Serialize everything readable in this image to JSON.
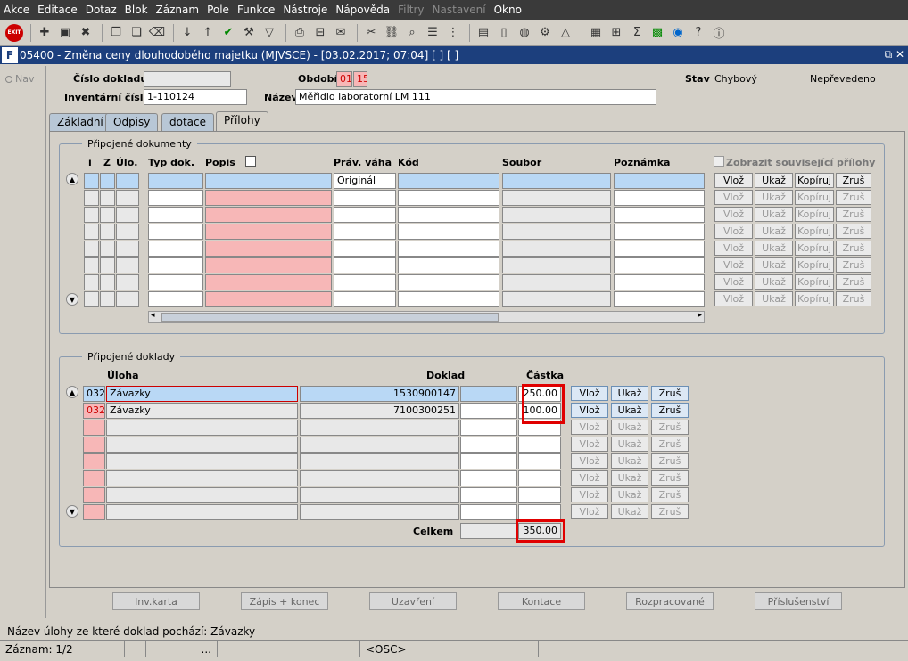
{
  "menu": [
    "Akce",
    "Editace",
    "Dotaz",
    "Blok",
    "Záznam",
    "Pole",
    "Funkce",
    "Nástroje",
    "Nápověda",
    "Filtry",
    "Nastavení",
    "Okno"
  ],
  "menu_disabled": [
    "Filtry",
    "Nastavení"
  ],
  "window": {
    "title": "05400 - Změna ceny dlouhodobého majetku (MJVSCE) - [03.02.2017; 07:04]  [ ] [ ]",
    "logo": "F"
  },
  "nav": {
    "label": "Nav"
  },
  "header": {
    "cislo_label": "Číslo dokladu",
    "cislo_value": "",
    "obdobi_label": "Období",
    "obdobi_1": "01",
    "obdobi_2": "15",
    "stav_label": "Stav",
    "stav_value": "Chybový",
    "stav_extra": "Nepřevedeno",
    "inv_label": "Inventární číslo",
    "inv_value": "1-110124",
    "nazev_label": "Název",
    "nazev_value": "Měřidlo laboratorní LM 111"
  },
  "tabs": [
    "Základní",
    "Odpisy",
    "dotace",
    "Přílohy"
  ],
  "dokumenty": {
    "title": "Připojené dokumenty",
    "cols": [
      "i",
      "Z",
      "Úlo.",
      "Typ dok.",
      "Popis",
      "Práv. váha",
      "Kód",
      "Soubor",
      "Poznámka"
    ],
    "show_related": "Zobrazit související přílohy",
    "first_row_vaha": "Originál",
    "btns": [
      "Vlož",
      "Ukaž",
      "Kopíruj",
      "Zruš"
    ]
  },
  "doklady": {
    "title": "Připojené doklady",
    "cols": {
      "uloha": "Úloha",
      "doklad": "Doklad",
      "castka": "Částka"
    },
    "rows": [
      {
        "code": "032",
        "uloha": "Závazky",
        "doklad": "1530900147",
        "castka": "250.00"
      },
      {
        "code": "032",
        "uloha": "Závazky",
        "doklad": "7100300251",
        "castka": "100.00"
      }
    ],
    "celkem_label": "Celkem",
    "celkem_value": "350.00",
    "btns": [
      "Vlož",
      "Ukaž",
      "Zruš"
    ]
  },
  "bottom_buttons": [
    "Inv.karta",
    "Zápis + konec",
    "Uzavření",
    "Kontace",
    "Rozpracované",
    "Příslušenství"
  ],
  "status": {
    "line1": "Název úlohy ze které doklad pochází: Závazky",
    "record": "Záznam: 1/2",
    "dots": "...",
    "osc": "<OSC>"
  }
}
